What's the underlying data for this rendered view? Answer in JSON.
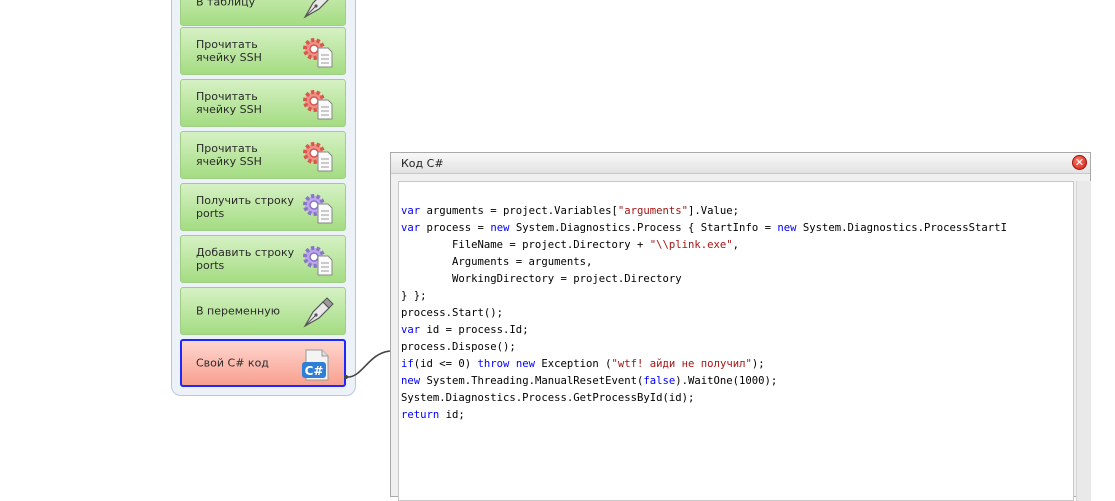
{
  "panel": {
    "blocks": [
      {
        "label": "В таблицу",
        "icon": "pen-nib-icon",
        "type": "green"
      },
      {
        "label": "Прочитать ячейку SSH",
        "icon": "gear-document-red-icon",
        "type": "green"
      },
      {
        "label": "Прочитать ячейку SSH",
        "icon": "gear-document-red-icon",
        "type": "green"
      },
      {
        "label": "Прочитать ячейку SSH",
        "icon": "gear-document-red-icon",
        "type": "green"
      },
      {
        "label": "Получить строку ports",
        "icon": "gear-document-purple-icon",
        "type": "green"
      },
      {
        "label": "Добавить строку ports",
        "icon": "gear-document-purple-icon",
        "type": "green"
      },
      {
        "label": "В переменную",
        "icon": "pen-nib-icon",
        "type": "green"
      },
      {
        "label": "Свой C# код",
        "icon": "csharp-document-icon",
        "type": "active"
      }
    ]
  },
  "window": {
    "title": "Код C#",
    "close_glyph": "✕"
  },
  "code": {
    "lines": [
      [
        {
          "t": "var",
          "c": "kw"
        },
        {
          "t": " arguments = project.Variables["
        },
        {
          "t": "\"arguments\"",
          "c": "str"
        },
        {
          "t": "].Value;"
        }
      ],
      [
        {
          "t": "var",
          "c": "kw"
        },
        {
          "t": " process = "
        },
        {
          "t": "new",
          "c": "kw"
        },
        {
          "t": " System.Diagnostics.Process { StartInfo = "
        },
        {
          "t": "new",
          "c": "kw"
        },
        {
          "t": " System.Diagnostics.ProcessStartI"
        }
      ],
      [
        {
          "t": "        FileName = project.Directory + "
        },
        {
          "t": "\"\\\\plink.exe\"",
          "c": "str"
        },
        {
          "t": ","
        }
      ],
      [
        {
          "t": "        Arguments = arguments,"
        }
      ],
      [
        {
          "t": "        WorkingDirectory = project.Directory"
        }
      ],
      [
        {
          "t": "} };"
        }
      ],
      [
        {
          "t": "process.Start();"
        }
      ],
      [
        {
          "t": "var",
          "c": "kw"
        },
        {
          "t": " id = process.Id;"
        }
      ],
      [
        {
          "t": "process.Dispose();"
        }
      ],
      [
        {
          "t": "if",
          "c": "kw"
        },
        {
          "t": "(id <= 0) "
        },
        {
          "t": "throw",
          "c": "kw"
        },
        {
          "t": " "
        },
        {
          "t": "new",
          "c": "kw"
        },
        {
          "t": " Exception ("
        },
        {
          "t": "\"wtf! айди не получил\"",
          "c": "str"
        },
        {
          "t": ");"
        }
      ],
      [
        {
          "t": "new",
          "c": "kw"
        },
        {
          "t": " System.Threading.ManualResetEvent("
        },
        {
          "t": "false",
          "c": "kw"
        },
        {
          "t": ").WaitOne(1000);"
        }
      ],
      [
        {
          "t": "System.Diagnostics.Process.GetProcessById(id);"
        }
      ],
      [
        {
          "t": "return",
          "c": "kw"
        },
        {
          "t": " id;"
        }
      ]
    ]
  }
}
